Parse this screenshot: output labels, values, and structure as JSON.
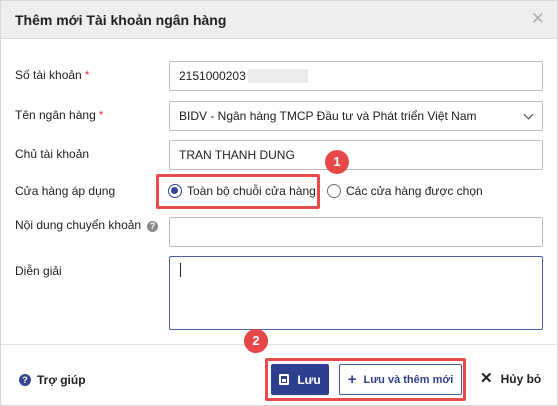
{
  "dialog": {
    "title": "Thêm mới Tài khoản ngân hàng",
    "close_icon": "close-icon"
  },
  "fields": {
    "account_number": {
      "label": "Số tài khoản",
      "required": "*",
      "value": "2151000203"
    },
    "bank_name": {
      "label": "Tên ngân hàng",
      "required": "*",
      "value": "BIDV - Ngân hàng TMCP Đầu tư và Phát triển Việt Nam"
    },
    "account_owner": {
      "label": "Chủ tài khoản",
      "value": "TRAN THANH DUNG"
    },
    "applied_stores": {
      "label": "Cửa hàng áp dụng",
      "options": [
        {
          "label": "Toàn bộ chuỗi cửa hàng",
          "selected": true
        },
        {
          "label": "Các cửa hàng được chọn",
          "selected": false
        }
      ]
    },
    "transfer_content": {
      "label": "Nội dung chuyển khoản",
      "help_icon": "?",
      "value": ""
    },
    "description": {
      "label": "Diễn giải",
      "value": ""
    }
  },
  "callouts": {
    "one": "1",
    "two": "2"
  },
  "footer": {
    "help_label": "Trợ giúp",
    "help_icon": "?",
    "save_label": "Lưu",
    "save_and_new_label": "Lưu và thêm mới",
    "cancel_label": "Hủy bỏ"
  },
  "colors": {
    "primary": "#2f3f8f",
    "callout": "#e84b4b",
    "required": "#e53935",
    "header_bg": "#eeeeee"
  }
}
